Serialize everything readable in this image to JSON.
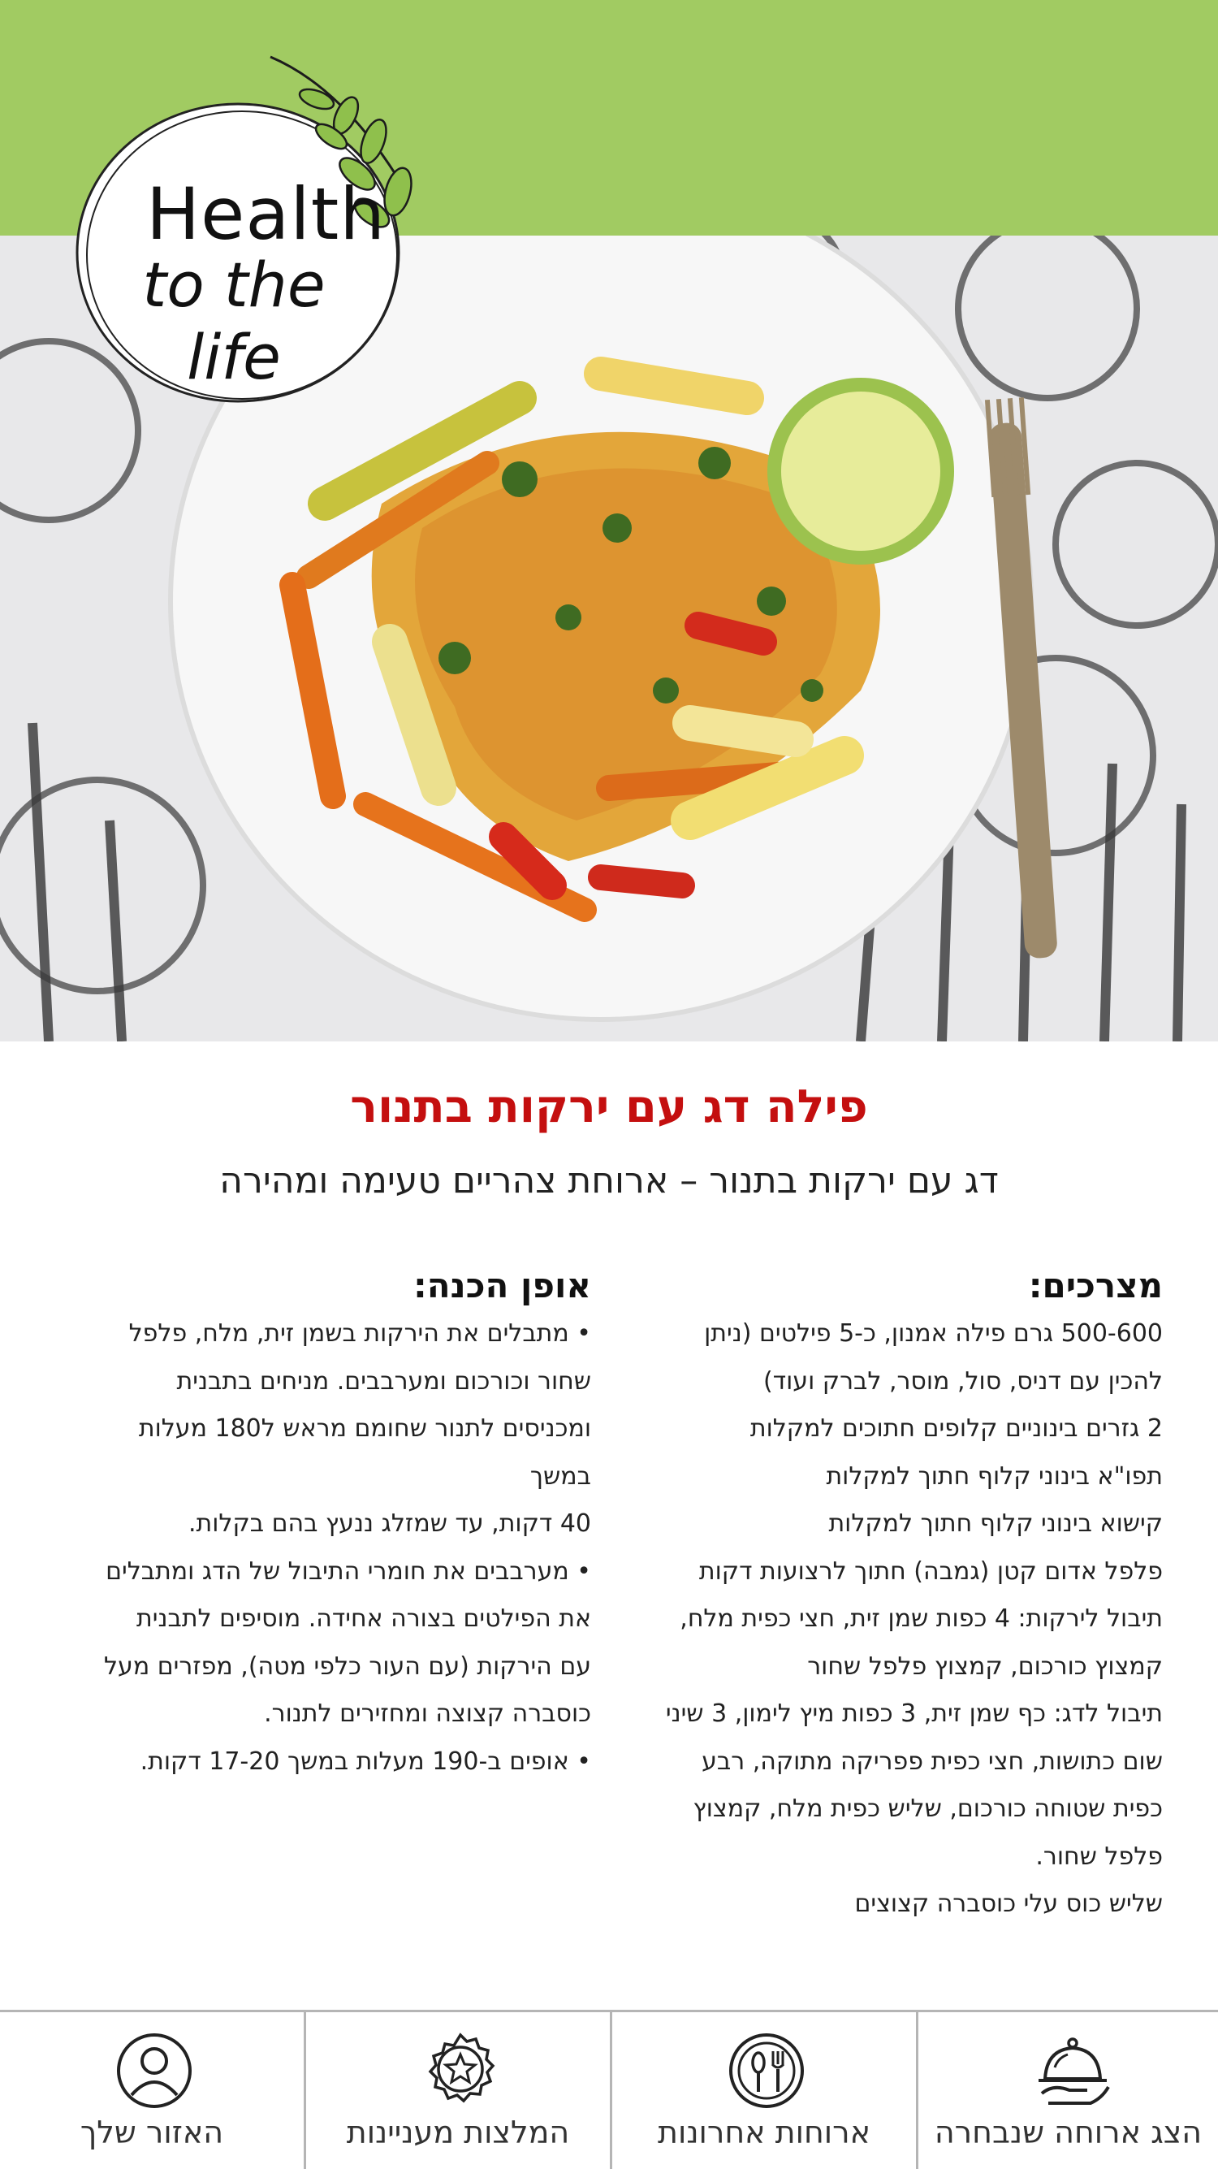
{
  "logo": {
    "line1": "Health",
    "line2": "to the life"
  },
  "recipe": {
    "title": "פילה דג עם ירקות בתנור",
    "subtitle": "דג עם ירקות בתנור – ארוחת צהריים טעימה ומהירה"
  },
  "ingredients": {
    "heading": "מצרכים:",
    "lines": [
      "500-600 גרם פילה אמנון, כ-5 פילטים (ניתן",
      "להכין עם דניס, סול, מוסר, לברק ועוד)",
      "2 גזרים בינוניים קלופים חתוכים למקלות",
      "תפו\"א בינוני קלוף חתוך למקלות",
      "קישוא בינוני קלוף חתוך למקלות",
      "פלפל אדום קטן (גמבה) חתוך לרצועות דקות",
      "תיבול לירקות: 4 כפות שמן זית, חצי כפית מלח,",
      "קמצוץ כורכום, קמצוץ פלפל שחור",
      "תיבול לדג: כף שמן זית, 3 כפות מיץ לימון, 3 שיני",
      "שום כתושות, חצי כפית פפריקה מתוקה, רבע",
      "כפית שטוחה כורכום, שליש כפית מלח, קמצוץ",
      "פלפל שחור.",
      "שליש כוס עלי כוסברה קצוצים"
    ]
  },
  "method": {
    "heading": "אופן הכנה:",
    "lines": [
      "• מתבלים את הירקות בשמן זית, מלח, פלפל",
      "שחור וכורכום ומערבבים. מניחים בתבנית",
      "ומכניסים לתנור שחומם מראש ל180 מעלות",
      "במשך",
      "40 דקות, עד שמזלג ננעץ בהם בקלות.",
      "• מערבבים את חומרי התיבול של הדג ומתבלים",
      "את הפילטים בצורה אחידה. מוסיפים לתבנית",
      "עם הירקות (עם העור כלפי מטה), מפזרים מעל",
      "כוסברה קצוצה ומחזירים לתנור.",
      "• אופים ב-190 מעלות במשך 17-20 דקות."
    ]
  },
  "nav": {
    "items": [
      {
        "label": "הצג ארוחה שנבחרה",
        "icon": "cloche-icon"
      },
      {
        "label": "ארוחות אחרונות",
        "icon": "plate-cutlery-icon"
      },
      {
        "label": "המלצות מעניינות",
        "icon": "star-badge-icon"
      },
      {
        "label": "האזור שלך",
        "icon": "user-icon"
      }
    ]
  },
  "colors": {
    "header_green": "#a1cb62",
    "title_red": "#c40f0f"
  }
}
